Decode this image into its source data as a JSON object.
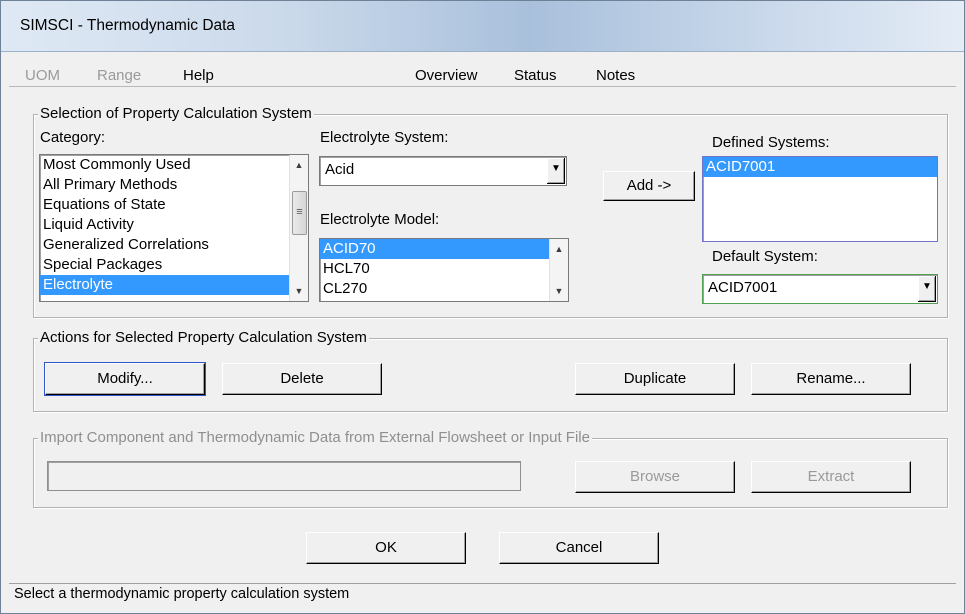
{
  "window": {
    "title": "SIMSCI - Thermodynamic Data"
  },
  "menubar": {
    "uom": "UOM",
    "range": "Range",
    "help": "Help",
    "overview": "Overview",
    "status": "Status",
    "notes": "Notes"
  },
  "selection_group": {
    "legend": "Selection of Property Calculation System",
    "category_label": "Category:",
    "categories": [
      "Most Commonly Used",
      "All Primary Methods",
      "Equations of State",
      "Liquid Activity",
      "Generalized Correlations",
      "Special Packages",
      "Electrolyte"
    ],
    "category_selected": "Electrolyte",
    "electrolyte_system_label": "Electrolyte System:",
    "electrolyte_system_value": "Acid",
    "electrolyte_model_label": "Electrolyte Model:",
    "models": [
      "ACID70",
      "HCL70",
      "CL270"
    ],
    "model_selected": "ACID70",
    "add_button": "Add ->",
    "defined_systems_label": "Defined Systems:",
    "defined_systems": [
      "ACID7001"
    ],
    "default_system_label": "Default System:",
    "default_system_value": "ACID7001"
  },
  "actions_group": {
    "legend": "Actions for Selected Property Calculation System",
    "modify": "Modify...",
    "delete": "Delete",
    "duplicate": "Duplicate",
    "rename": "Rename..."
  },
  "import_group": {
    "legend": "Import Component and Thermodynamic Data from External Flowsheet or Input File",
    "browse": "Browse",
    "extract": "Extract"
  },
  "footer": {
    "ok": "OK",
    "cancel": "Cancel"
  },
  "statusbar": {
    "text": "Select a thermodynamic property calculation system"
  }
}
